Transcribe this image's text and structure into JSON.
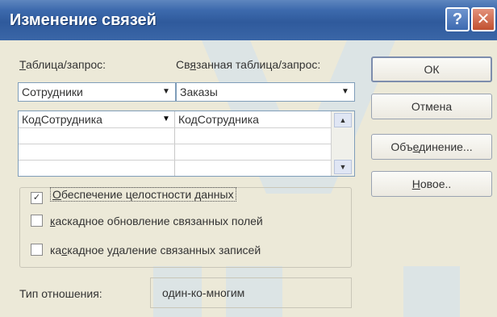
{
  "window": {
    "title": "Изменение связей",
    "help_label": "?",
    "close_label": "✕"
  },
  "table": {
    "label_prefix": "",
    "label_key": "Т",
    "label_rest": "аблица/запрос:",
    "value": "Сотрудники"
  },
  "related_table": {
    "label_prefix": "Св",
    "label_key": "я",
    "label_rest": "занная таблица/запрос:",
    "value": "Заказы"
  },
  "fields": {
    "rows": [
      {
        "left": "КодСотрудника",
        "right": "КодСотрудника"
      },
      {
        "left": "",
        "right": ""
      },
      {
        "left": "",
        "right": ""
      }
    ]
  },
  "options": {
    "integrity": {
      "key": "О",
      "rest": "беспечение целостности данных",
      "checked": true
    },
    "cascade_update": {
      "key": "к",
      "rest": "аскадное обновление связанных полей",
      "checked": false
    },
    "cascade_delete": {
      "prefix": "ка",
      "key": "с",
      "rest": "кадное удаление связанных записей",
      "checked": false
    }
  },
  "buttons": {
    "ok": "ОК",
    "cancel": "Отмена",
    "join_prefix": "Объ",
    "join_key": "е",
    "join_rest": "динение...",
    "new_key": "Н",
    "new_rest": "овое.."
  },
  "relationship": {
    "label": "Тип отношения:",
    "value": "один-ко-многим"
  },
  "icons": [
    "help-icon",
    "close-icon",
    "dropdown-arrow-icon",
    "scroll-up-icon",
    "scroll-down-icon",
    "checkmark-icon"
  ],
  "colors": {
    "titlebar": "#2f5a9c",
    "dialog_bg": "#ece9d8",
    "watermark": "#cfe0f0"
  }
}
